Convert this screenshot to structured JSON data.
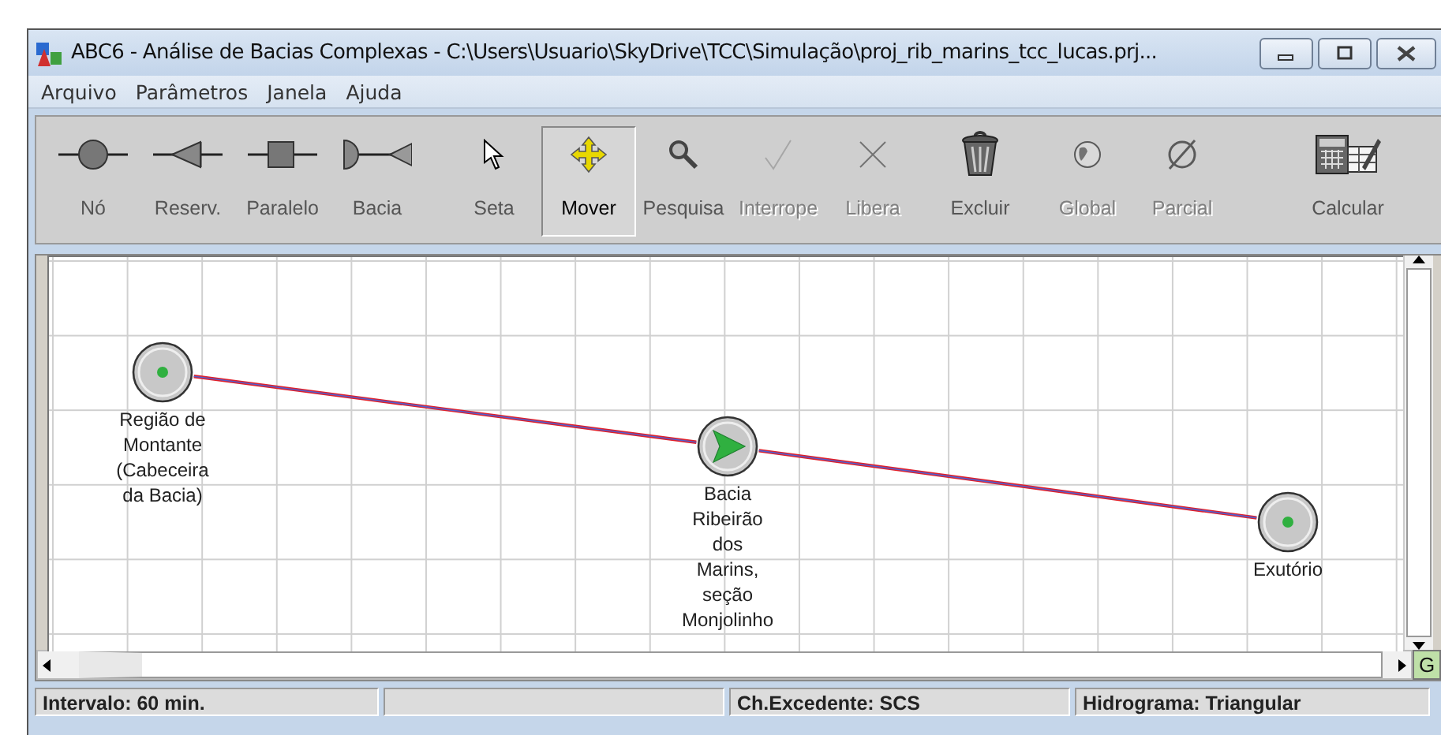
{
  "window": {
    "title": "ABC6 - Análise de Bacias Complexas - C:\\Users\\Usuario\\SkyDrive\\TCC\\Simulação\\proj_rib_marins_tcc_lucas.prj..."
  },
  "menu": [
    "Arquivo",
    "Parâmetros",
    "Janela",
    "Ajuda"
  ],
  "toolbar": [
    {
      "kind": "node",
      "label": "Nó",
      "disabled": false,
      "selected": false
    },
    {
      "kind": "reservoir",
      "label": "Reserv.",
      "disabled": false,
      "selected": false
    },
    {
      "kind": "parallel",
      "label": "Paralelo",
      "disabled": false,
      "selected": false
    },
    {
      "kind": "basin",
      "label": "Bacia",
      "disabled": false,
      "selected": false
    },
    {
      "kind": "pointer",
      "label": "Seta",
      "disabled": false,
      "selected": false
    },
    {
      "kind": "move",
      "label": "Mover",
      "disabled": false,
      "selected": true
    },
    {
      "kind": "search",
      "label": "Pesquisa",
      "disabled": false,
      "selected": false
    },
    {
      "kind": "interrupt",
      "label": "Interrope",
      "disabled": true,
      "selected": false
    },
    {
      "kind": "release",
      "label": "Libera",
      "disabled": true,
      "selected": false
    },
    {
      "kind": "delete",
      "label": "Excluir",
      "disabled": false,
      "selected": false
    },
    {
      "kind": "global",
      "label": "Global",
      "disabled": true,
      "selected": false
    },
    {
      "kind": "partial",
      "label": "Parcial",
      "disabled": true,
      "selected": false
    },
    {
      "kind": "calculate",
      "label": "Calcular",
      "disabled": false,
      "selected": false
    }
  ],
  "canvas": {
    "nodes": [
      {
        "kind": "node",
        "label": "Região de\nMontante\n(Cabeceira\nda Bacia)"
      },
      {
        "kind": "basin",
        "label": "Bacia\nRibeirão\ndos\nMarins,\nseção\nMonjolinho"
      },
      {
        "kind": "node",
        "label": "Exutório"
      }
    ],
    "corner_button": "G"
  },
  "status_bar": [
    "Intervalo: 60 min.",
    "Ch.Excedente: SCS",
    "Hidrograma: Triangular"
  ]
}
